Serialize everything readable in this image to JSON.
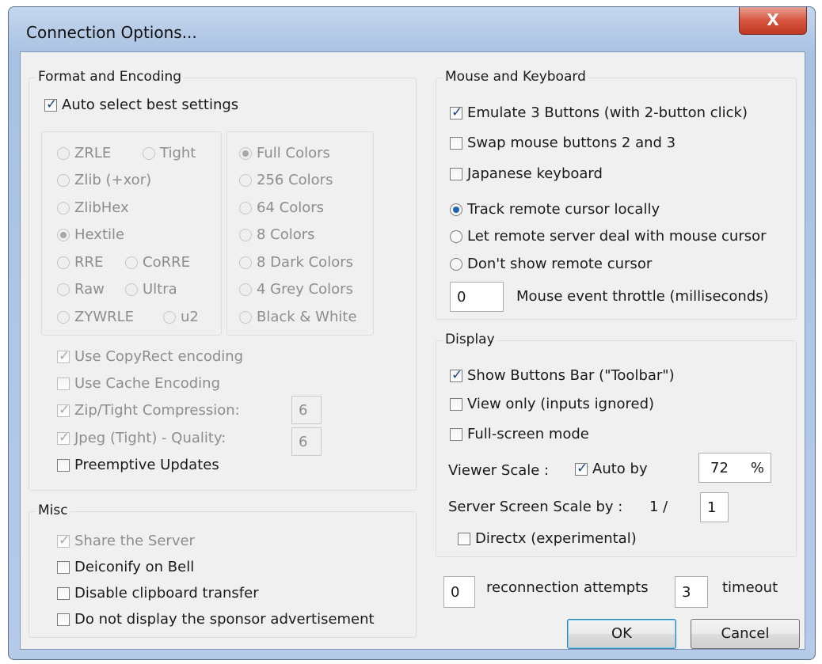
{
  "window": {
    "title": "Connection Options...",
    "close_label": "X"
  },
  "format": {
    "group_label": "Format and Encoding",
    "auto_select": "Auto select best settings",
    "encodings": [
      "ZRLE",
      "Tight",
      "Zlib (+xor)",
      "ZlibHex",
      "Hextile",
      "RRE",
      "CoRRE",
      "Raw",
      "Ultra",
      "ZYWRLE",
      "u2"
    ],
    "colors": [
      "Full Colors",
      "256 Colors",
      "64 Colors",
      "8 Colors",
      "8 Dark Colors",
      "4 Grey Colors",
      "Black & White"
    ],
    "copyrect": "Use CopyRect encoding",
    "cache": "Use Cache Encoding",
    "zip_label": "Zip/Tight Compression:",
    "zip_value": "6",
    "jpeg_label": "Jpeg (Tight) - Quality:",
    "jpeg_value": "6",
    "preemptive": "Preemptive Updates"
  },
  "misc": {
    "group_label": "Misc",
    "share": "Share the Server",
    "deiconify": "Deiconify on Bell",
    "disable_clipboard": "Disable clipboard transfer",
    "no_sponsor": "Do not display the sponsor advertisement"
  },
  "mouse": {
    "group_label": "Mouse and Keyboard",
    "emulate3": "Emulate 3 Buttons (with 2-button click)",
    "swap": "Swap mouse buttons 2 and 3",
    "japanese": "Japanese keyboard",
    "track": "Track remote cursor locally",
    "let_server": "Let remote server deal with mouse cursor",
    "dont_show": "Don't show remote cursor",
    "throttle_value": "0",
    "throttle_label": "Mouse event throttle (milliseconds)"
  },
  "display": {
    "group_label": "Display",
    "toolbar": "Show Buttons Bar (\"Toolbar\")",
    "view_only": "View only (inputs ignored)",
    "fullscreen": "Full-screen mode",
    "viewer_scale_label": "Viewer Scale :",
    "auto_by": "Auto by",
    "scale_value": "72",
    "percent": "%",
    "server_scale_label": "Server Screen Scale by :",
    "server_scale_prefix": "1 /",
    "server_scale_value": "1",
    "directx": "Directx (experimental)"
  },
  "bottom": {
    "reconnect_value": "0",
    "reconnect_label": "reconnection attempts",
    "timeout_value": "3",
    "timeout_label": "timeout",
    "ok": "OK",
    "cancel": "Cancel"
  }
}
